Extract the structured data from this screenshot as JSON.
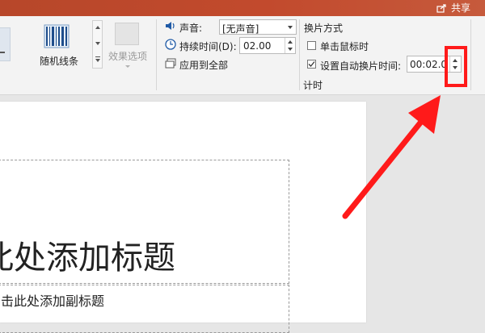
{
  "titlebar": {
    "share_label": "共享"
  },
  "ribbon": {
    "effect_random_bars_label": "随机线条",
    "effect_options_label": "效果选项",
    "sound_label": "声音:",
    "sound_value": "[无声音]",
    "duration_label": "持续时间(D):",
    "duration_value": "02.00",
    "apply_all_label": "应用到全部",
    "advance_group_title": "换片方式",
    "on_click_label": "单击鼠标时",
    "after_time_label": "设置自动换片时间:",
    "after_time_value": "00:02.0",
    "timing_group_label": "计时"
  },
  "slide": {
    "title_placeholder": "此处添加标题",
    "subtitle_placeholder": "击此处添加副标题"
  },
  "colors": {
    "titlebar": "#b7472a",
    "highlight": "#ff1a1a"
  }
}
